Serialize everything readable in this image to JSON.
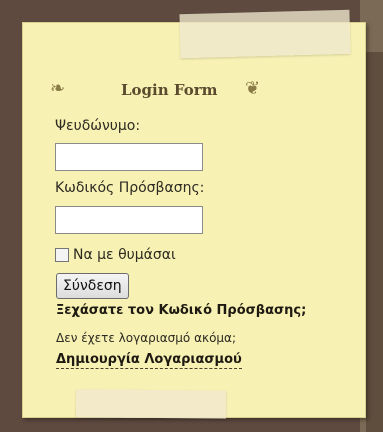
{
  "login_form": {
    "title": "Login Form",
    "ornament_left": "❧",
    "ornament_right": "❦",
    "username_label": "Ψευδώνυμο:",
    "username_value": "",
    "password_label": "Κωδικός Πρόσβασης:",
    "password_value": "",
    "remember_label": "Να με θυμάσαι",
    "submit_label": "Σύνδεση",
    "forgot_link": "Ξεχάσατε τον Κωδικό Πρόσβασης;",
    "no_account_text": "Δεν έχετε λογαριασμό ακόμα;",
    "register_link": "Δημιουργία Λογαριασμού"
  },
  "colors": {
    "background": "#5e4a3f",
    "note": "#f7f1b4",
    "title": "#5a4a2e"
  }
}
